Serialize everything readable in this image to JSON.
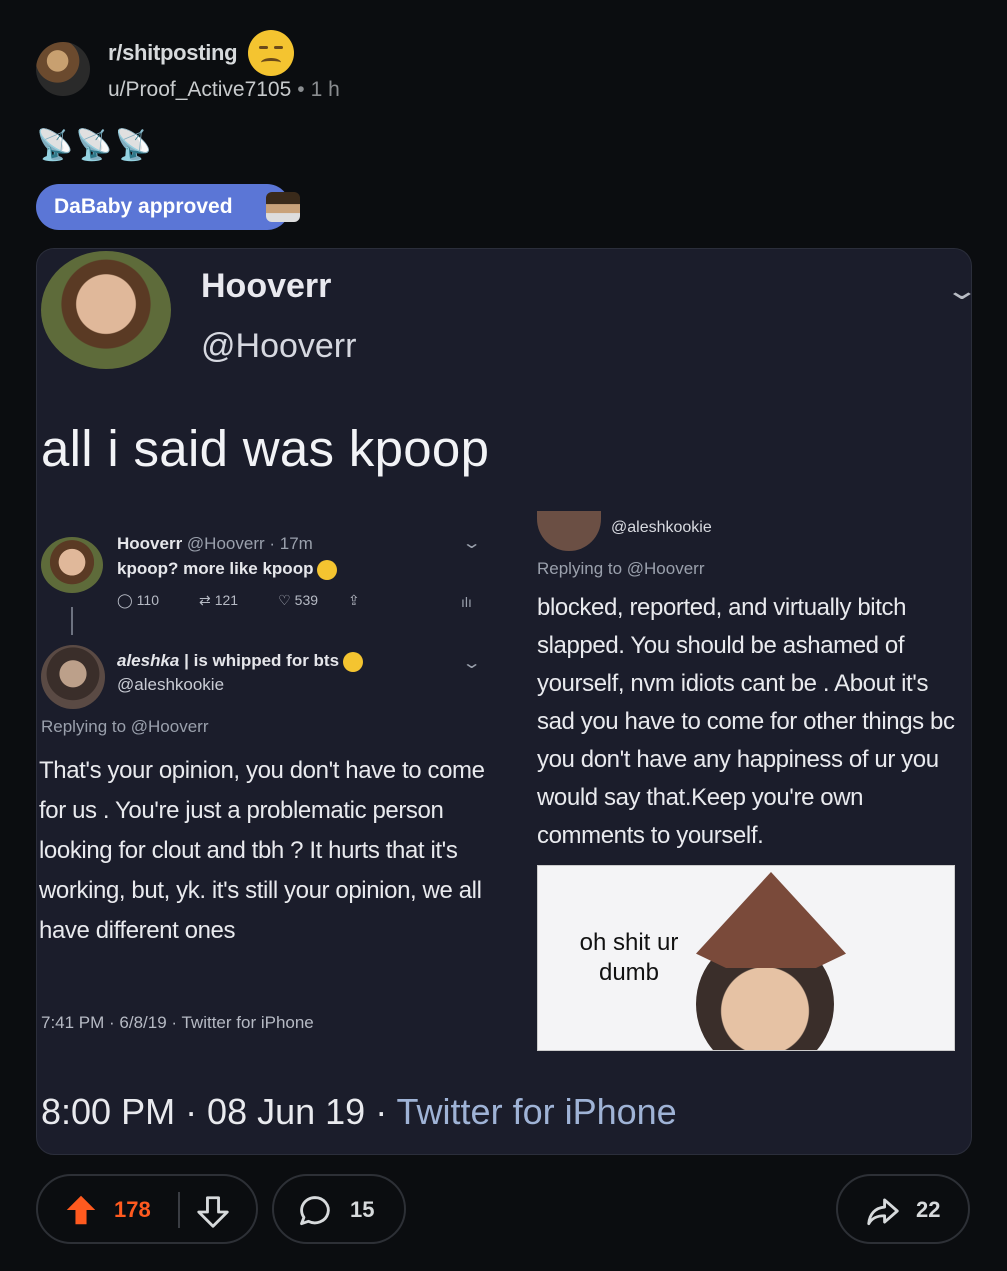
{
  "post": {
    "subreddit": "r/shitposting",
    "author": "u/Proof_Active7105",
    "time": "1 h",
    "title": "📡📡📡",
    "flair": "DaBaby approved"
  },
  "tweet": {
    "name": "Hooverr",
    "handle": "@Hooverr",
    "text": "all i said was kpoop",
    "footer_time": "8:00 PM · 08 Jun 19 · ",
    "footer_source": "Twitter for iPhone",
    "inner_tweet": {
      "name": "Hooverr",
      "handle_time": "@Hooverr · 17m",
      "text": "kpoop? more like kpoop",
      "replies": "110",
      "retweets": "121",
      "likes": "539"
    },
    "reply": {
      "name_prefix": "aleshka",
      "name_suffix": " | is whipped for bts",
      "handle": "@aleshkookie",
      "replying_to": "Replying to @Hooverr",
      "body": "That's your opinion, you don't have to come for us . You're just a problematic person looking for clout and tbh ? It hurts that it's working, but, yk. it's still your opinion, we all have different ones",
      "footer": "7:41 PM · 6/8/19 · Twitter for iPhone"
    },
    "right_reply": {
      "handle": "@aleshkookie",
      "replying_to": "Replying to @Hooverr",
      "body": "blocked, reported, and virtually bitch slapped. You should be ashamed of yourself, nvm idiots cant be . About it's sad you have to come for other things bc you don't have any happiness of ur you would say that.Keep you're own comments to yourself.",
      "meme_caption": "oh shit ur dumb"
    }
  },
  "actions": {
    "upvotes": "178",
    "comments": "15",
    "shares": "22"
  },
  "colors": {
    "background": "#0b0d10",
    "flair": "#5b76d6",
    "upvote": "#ff5a1f",
    "media_bg": "#1b1d2b"
  }
}
